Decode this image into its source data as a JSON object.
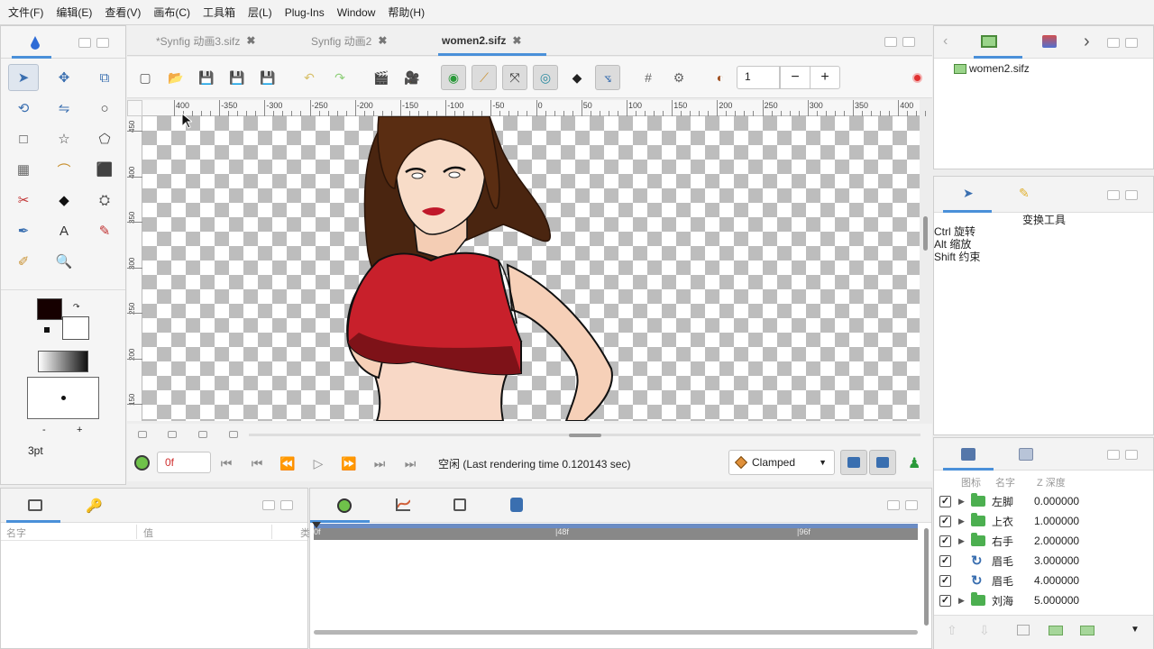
{
  "menubar": [
    "文件(F)",
    "编辑(E)",
    "查看(V)",
    "画布(C)",
    "工具箱",
    "层(L)",
    "Plug-Ins",
    "Window",
    "帮助(H)"
  ],
  "tabs": [
    {
      "label": "*Synfig 动画3.sifz",
      "active": false
    },
    {
      "label": "Synfig 动画2",
      "active": false
    },
    {
      "label": "women2.sifz",
      "active": true
    }
  ],
  "toolbox": {
    "brush_size": "3pt",
    "minus": "-",
    "plus": "+",
    "tools": [
      "transform-tool",
      "smooth-move-tool",
      "scale-tool",
      "rotate-tool",
      "mirror-tool",
      "circle-tool",
      "rectangle-tool",
      "star-tool",
      "polygon-tool",
      "gradient-tool",
      "spline-tool",
      "fill-tool",
      "cutout-tool",
      "width-tool",
      "bone-tool",
      "eyedropper-tool",
      "text-tool",
      "sketch-tool",
      "brush-tool",
      "zoom-tool"
    ]
  },
  "canvas_toolbar": {
    "frame_spin_value": "1",
    "minus": "−",
    "plus": "+"
  },
  "rulers": {
    "h_labels": [
      "400",
      "-350",
      "-300",
      "-250",
      "-200",
      "-150",
      "-100",
      "-50",
      "0",
      "50",
      "100",
      "150",
      "200",
      "250",
      "300",
      "350",
      "400"
    ],
    "v_labels": [
      "450",
      "400",
      "350",
      "300",
      "250",
      "200",
      "150"
    ]
  },
  "playback": {
    "time_value": "0f",
    "status_text": "空闲 (Last rendering time 0.120143 sec)",
    "interpolation": "Clamped"
  },
  "canvas_browser": {
    "file": "women2.sifz"
  },
  "tool_options": {
    "title": "变换工具",
    "lines": [
      "Ctrl 旋转",
      "Alt 缩放",
      "Shift 约束"
    ]
  },
  "params": {
    "col_name": "名字",
    "col_value": "值",
    "col_type": "类"
  },
  "timetrack": {
    "marks": [
      "0f",
      "|48f",
      "|96f"
    ]
  },
  "layers": {
    "col_icon": "图标",
    "col_name": "名字",
    "col_z": "Z 深度",
    "rows": [
      {
        "name": "左脚",
        "z": "0.000000",
        "kind": "group",
        "checked": true
      },
      {
        "name": "上衣",
        "z": "1.000000",
        "kind": "group",
        "checked": true
      },
      {
        "name": "右手",
        "z": "2.000000",
        "kind": "group",
        "checked": true
      },
      {
        "name": "眉毛",
        "z": "3.000000",
        "kind": "rotate",
        "checked": true
      },
      {
        "name": "眉毛",
        "z": "4.000000",
        "kind": "rotate",
        "checked": true
      },
      {
        "name": "刘海",
        "z": "5.000000",
        "kind": "group",
        "checked": true
      }
    ]
  },
  "colors": {
    "outline": "#160000",
    "fill": "#ffffff",
    "accent": "#4a90d9",
    "record": "#e03030"
  }
}
